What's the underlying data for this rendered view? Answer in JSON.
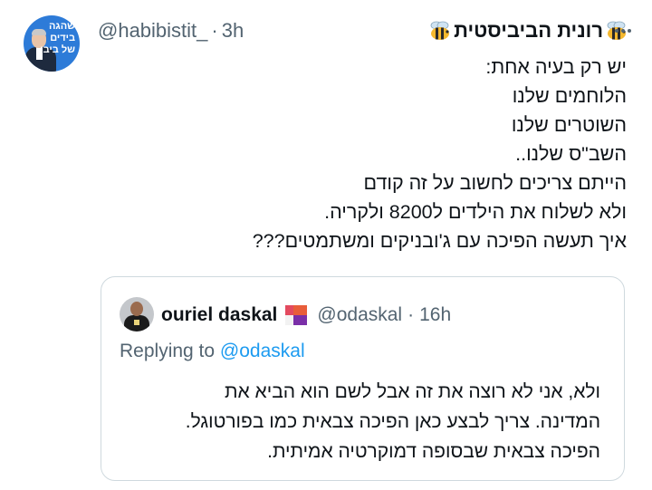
{
  "tweet": {
    "author": {
      "display_name": "רונית הביביסטית",
      "handle": "@habibistit_",
      "separator": "·",
      "time": "3h",
      "avatar_text": "שהגה בידים של ביבי"
    },
    "body_lines": [
      "יש רק בעיה אחת:",
      "הלוחמים שלנו",
      "השוטרים שלנו",
      "השב\"ס שלנו..",
      "הייתם צריכים לחשוב על זה קודם",
      "ולא לשלוח את הילדים ל8200 ולקריה.",
      "איך תעשה הפיכה עם ג'ובניקים ומשתמטים???"
    ],
    "icons": {
      "bee": "bee-emoji-icon",
      "more": "more-horizontal-icon",
      "flag": "flag-emoji-icon"
    }
  },
  "quoted_tweet": {
    "author": {
      "display_name": "ouriel daskal",
      "handle": "@odaskal",
      "separator": "·",
      "time": "16h"
    },
    "replying_prefix": "Replying to",
    "replying_to": "@odaskal",
    "body_lines": [
      "ולא, אני לא רוצה את זה אבל לשם הוא הביא את",
      "המדינה. צריך לבצע כאן הפיכה צבאית כמו בפורטוגל.",
      "הפיכה צבאית שבסופה דמוקרטיה אמיתית."
    ]
  },
  "colors": {
    "text_primary": "#0f1419",
    "text_secondary": "#536471",
    "link": "#1d9bf0",
    "border": "#cfd9de",
    "avatar_blue": "#2d7bd8"
  }
}
